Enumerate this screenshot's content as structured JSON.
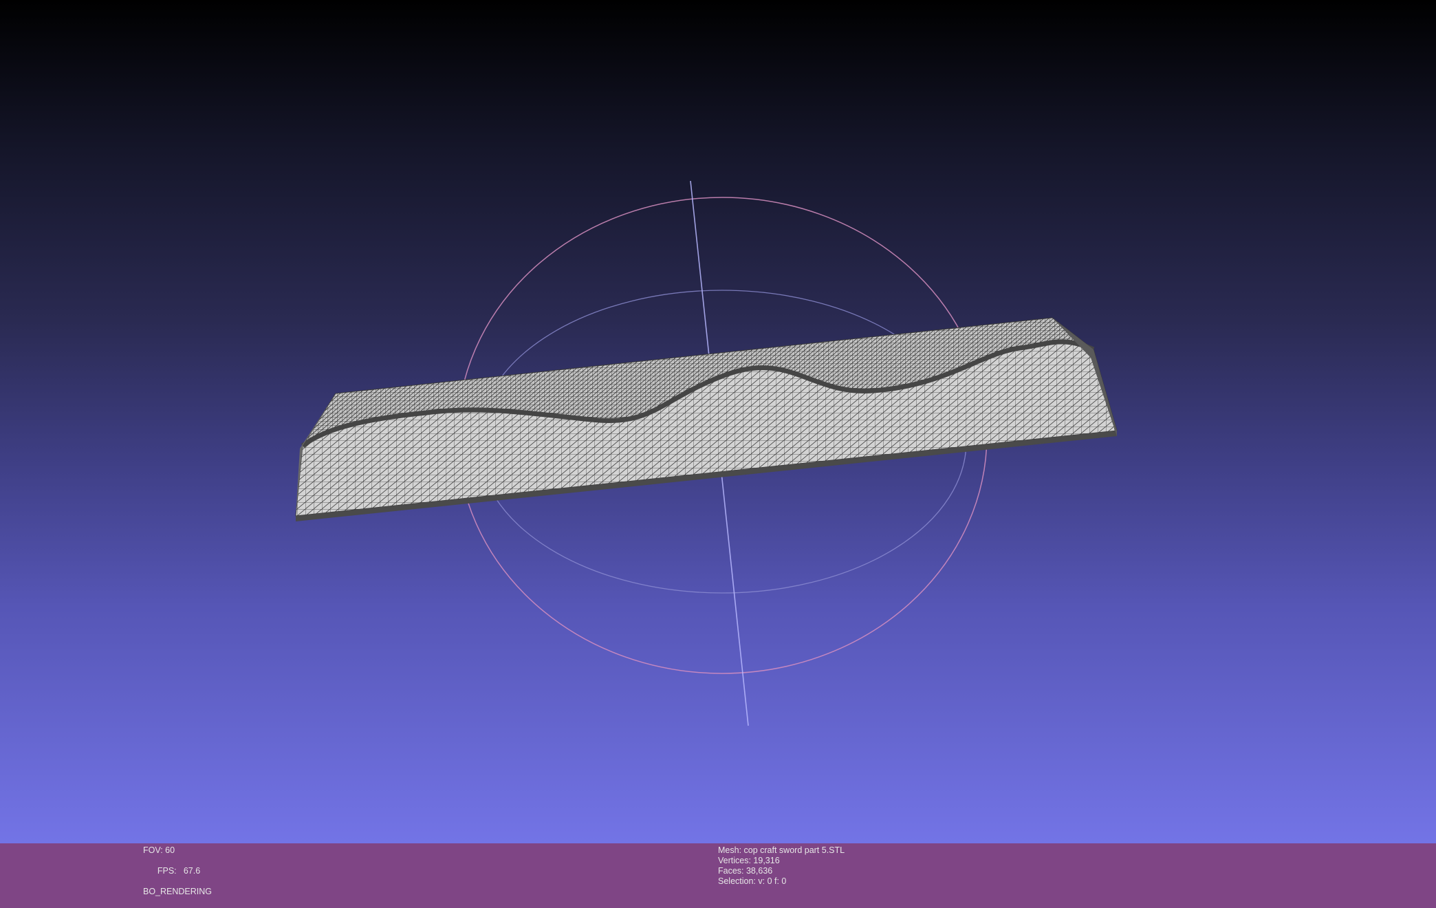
{
  "viewport": {
    "background_top": "#000000",
    "background_bottom": "#7374e6",
    "mesh_face_color": "#cfcfcf",
    "mesh_wire_color": "#333333",
    "trackball_colors": [
      "#d68ec0",
      "#8d8dd2",
      "#b8b8ff"
    ]
  },
  "status_left": {
    "fov": "FOV: 60",
    "fps_label": "FPS:",
    "fps_value": "67.6",
    "render_mode": "BO_RENDERING"
  },
  "status_right": {
    "mesh": "Mesh: cop craft sword part 5.STL",
    "vertices": "Vertices: 19,316",
    "faces": "Faces: 38,636",
    "selection": "Selection: v: 0 f: 0"
  },
  "infobar_color": "#7f4585"
}
